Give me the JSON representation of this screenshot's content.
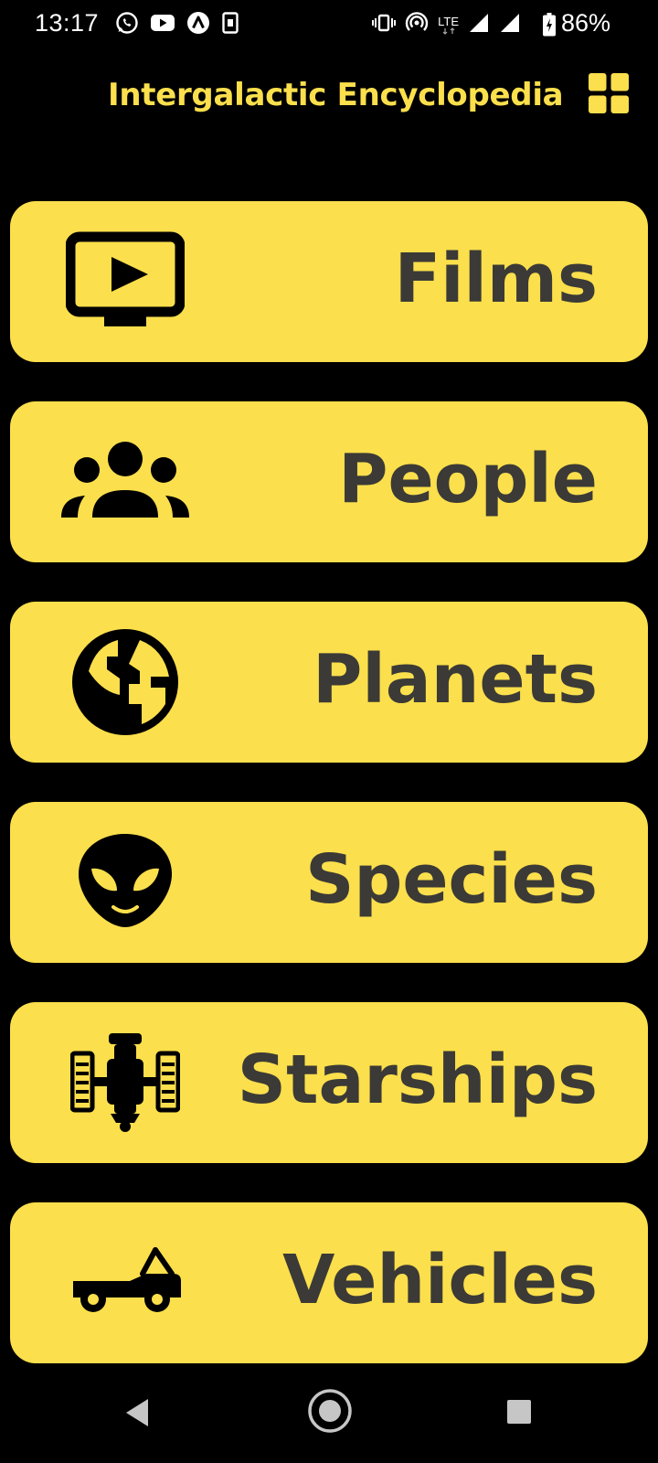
{
  "status_bar": {
    "time": "13:17",
    "network": "LTE",
    "battery": "86%",
    "left_icons": [
      "whatsapp-icon",
      "youtube-icon",
      "app-icon",
      "sim-icon"
    ],
    "right_icons": [
      "vibrate-icon",
      "hotspot-icon",
      "lte-icon",
      "signal-icon",
      "signal-icon",
      "battery-icon"
    ]
  },
  "app_bar": {
    "title": "Intergalactic Encyclopedia",
    "action_icon": "grid-view-icon"
  },
  "menu": {
    "items": [
      {
        "label": "Films",
        "icon": "tv-play-icon"
      },
      {
        "label": "People",
        "icon": "people-group-icon"
      },
      {
        "label": "Planets",
        "icon": "globe-icon"
      },
      {
        "label": "Species",
        "icon": "alien-icon"
      },
      {
        "label": "Starships",
        "icon": "space-station-icon"
      },
      {
        "label": "Vehicles",
        "icon": "buggy-icon"
      }
    ]
  },
  "nav_bar": {
    "buttons": [
      "back-icon",
      "home-icon",
      "recent-apps-icon"
    ]
  },
  "colors": {
    "background": "#000000",
    "accent": "#fbdf4c",
    "card_text": "#3b3a36"
  }
}
